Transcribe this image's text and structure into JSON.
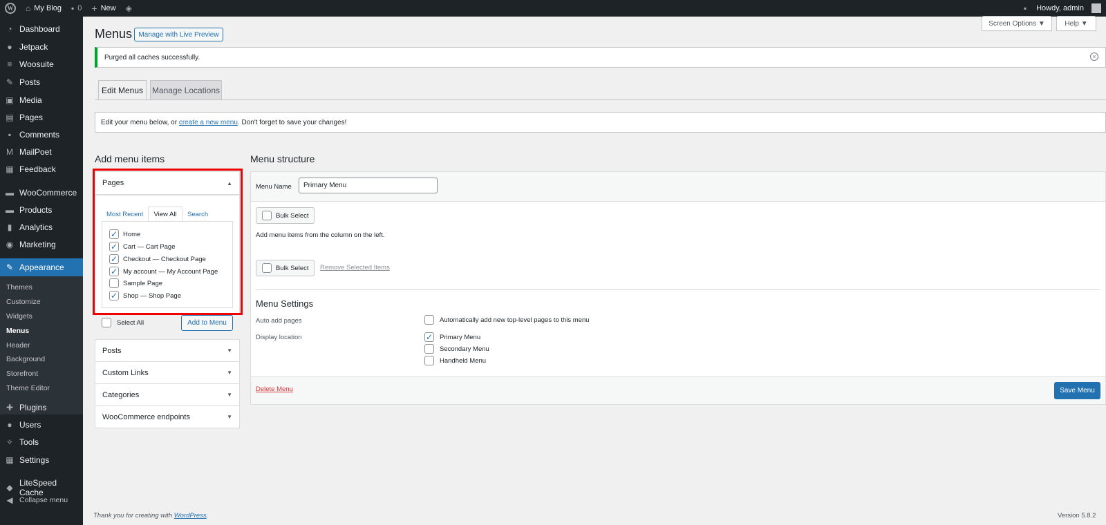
{
  "adminbar": {
    "site_name": "My Blog",
    "comments_count": "0",
    "new_label": "New",
    "greeting": "Howdy, admin"
  },
  "sidebar": {
    "items": [
      {
        "label": "Dashboard",
        "icon": "dashboard-icon"
      },
      {
        "label": "Jetpack",
        "icon": "jetpack-icon"
      },
      {
        "label": "Woosuite",
        "icon": "woosuite-icon"
      },
      {
        "label": "Posts",
        "icon": "pin-icon"
      },
      {
        "label": "Media",
        "icon": "media-icon"
      },
      {
        "label": "Pages",
        "icon": "pages-icon"
      },
      {
        "label": "Comments",
        "icon": "comment-icon"
      },
      {
        "label": "MailPoet",
        "icon": "mailpoet-icon"
      },
      {
        "label": "Feedback",
        "icon": "feedback-icon"
      },
      {
        "label": "WooCommerce",
        "icon": "woo-icon"
      },
      {
        "label": "Products",
        "icon": "products-icon"
      },
      {
        "label": "Analytics",
        "icon": "analytics-icon"
      },
      {
        "label": "Marketing",
        "icon": "marketing-icon"
      },
      {
        "label": "Appearance",
        "icon": "brush-icon"
      },
      {
        "label": "Plugins",
        "icon": "plugin-icon"
      },
      {
        "label": "Users",
        "icon": "users-icon"
      },
      {
        "label": "Tools",
        "icon": "tools-icon"
      },
      {
        "label": "Settings",
        "icon": "settings-icon"
      },
      {
        "label": "LiteSpeed Cache",
        "icon": "litespeed-icon"
      },
      {
        "label": "Collapse menu",
        "icon": "collapse-icon"
      }
    ],
    "submenu": [
      "Themes",
      "Customize",
      "Widgets",
      "Menus",
      "Header",
      "Background",
      "Storefront",
      "Theme Editor"
    ]
  },
  "header": {
    "title": "Menus",
    "live_preview": "Manage with Live Preview",
    "screen_options": "Screen Options ▼",
    "help": "Help ▼"
  },
  "notice": {
    "text": "Purged all caches successfully."
  },
  "tabs": {
    "edit": "Edit Menus",
    "locations": "Manage Locations"
  },
  "info": {
    "before": "Edit your menu below, or ",
    "link": "create a new menu",
    "after": ". Don't forget to save your changes!"
  },
  "add_items": {
    "heading": "Add menu items",
    "pages_title": "Pages",
    "page_tabs": [
      "Most Recent",
      "View All",
      "Search"
    ],
    "pages": [
      {
        "label": "Home",
        "checked": true
      },
      {
        "label": "Cart — Cart Page",
        "checked": true
      },
      {
        "label": "Checkout — Checkout Page",
        "checked": true
      },
      {
        "label": "My account — My Account Page",
        "checked": true
      },
      {
        "label": "Sample Page",
        "checked": false
      },
      {
        "label": "Shop — Shop Page",
        "checked": true
      }
    ],
    "select_all": "Select All",
    "add_button": "Add to Menu",
    "sections": [
      "Posts",
      "Custom Links",
      "Categories",
      "WooCommerce endpoints"
    ]
  },
  "structure": {
    "heading": "Menu structure",
    "name_label": "Menu Name",
    "name_value": "Primary Menu",
    "bulk_select": "Bulk Select",
    "hint": "Add menu items from the column on the left.",
    "remove_selected": "Remove Selected Items",
    "settings_heading": "Menu Settings",
    "auto_add_label": "Auto add pages",
    "auto_add_text": "Automatically add new top-level pages to this menu",
    "display_label": "Display location",
    "locations": [
      {
        "label": "Primary Menu",
        "checked": true
      },
      {
        "label": "Secondary Menu",
        "checked": false
      },
      {
        "label": "Handheld Menu",
        "checked": false
      }
    ],
    "delete": "Delete Menu",
    "save": "Save Menu"
  },
  "footer": {
    "before": "Thank you for creating with ",
    "link": "WordPress",
    "after": ".",
    "version": "Version 5.8.2"
  }
}
